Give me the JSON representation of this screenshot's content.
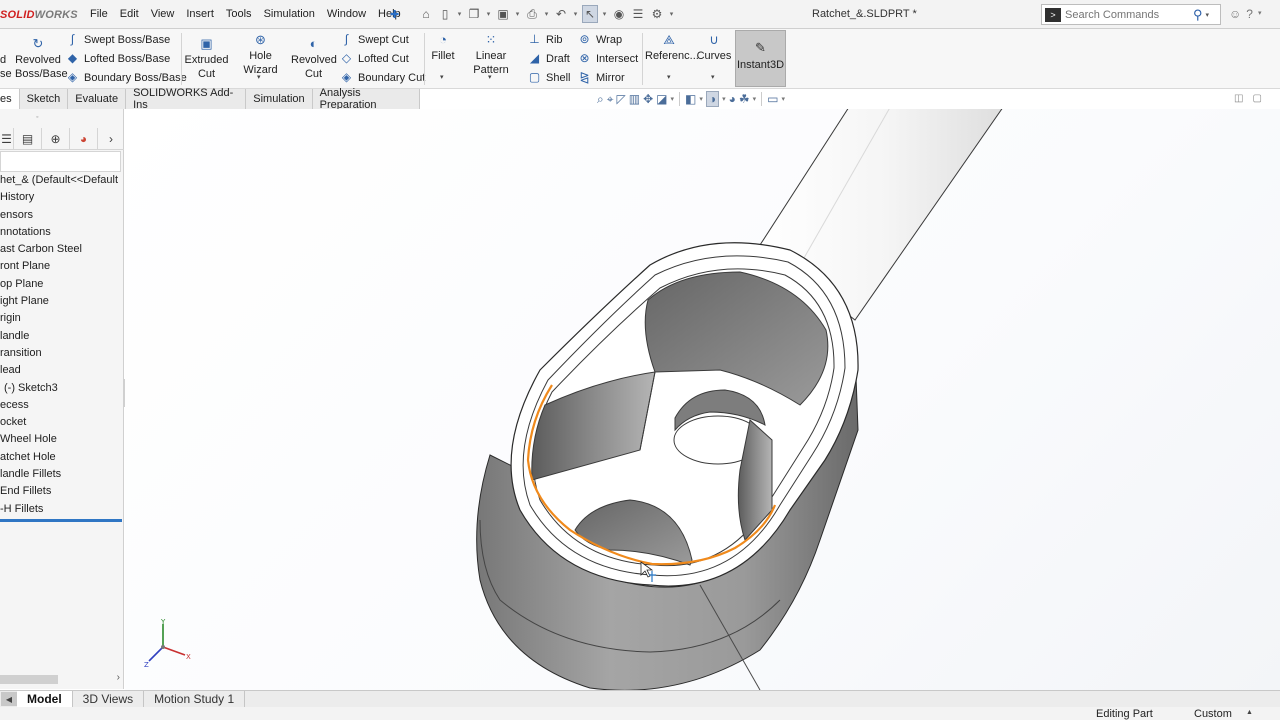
{
  "app": {
    "logo_red": "SOLID",
    "logo_grey": "WORKS",
    "document_title": "Ratchet_&.SLDPRT *"
  },
  "menu": [
    "File",
    "Edit",
    "View",
    "Insert",
    "Tools",
    "Simulation",
    "Window",
    "Help"
  ],
  "quick_access_icons": [
    "home-icon",
    "new-document-icon",
    "open-icon",
    "save-icon",
    "print-icon",
    "undo-icon",
    "select-icon",
    "rebuild-icon",
    "file-properties-icon",
    "options-icon"
  ],
  "search": {
    "placeholder": "Search Commands"
  },
  "command_manager": {
    "extruded_boss_partial_top": "d",
    "extruded_boss_partial_bottom": "se",
    "revolved_boss": "Revolved Boss/Base",
    "swept_boss": "Swept Boss/Base",
    "lofted_boss": "Lofted Boss/Base",
    "boundary_boss": "Boundary Boss/Base",
    "extruded_cut": "Extruded Cut",
    "hole_wizard": "Hole Wizard",
    "revolved_cut": "Revolved Cut",
    "swept_cut": "Swept Cut",
    "lofted_cut": "Lofted Cut",
    "boundary_cut": "Boundary Cut",
    "fillet": "Fillet",
    "linear_pattern": "Linear Pattern",
    "rib": "Rib",
    "draft": "Draft",
    "shell": "Shell",
    "wrap": "Wrap",
    "intersect": "Intersect",
    "mirror": "Mirror",
    "reference_geometry": "Referenc...",
    "curves": "Curves",
    "instant3d": "Instant3D"
  },
  "tabs": [
    {
      "label": "es",
      "active": true
    },
    {
      "label": "Sketch",
      "active": false
    },
    {
      "label": "Evaluate",
      "active": false
    },
    {
      "label": "SOLIDWORKS Add-Ins",
      "active": false
    },
    {
      "label": "Simulation",
      "active": false
    },
    {
      "label": "Analysis Preparation",
      "active": false
    }
  ],
  "feature_tree": [
    "het_&  (Default<<Default",
    "History",
    "ensors",
    "nnotations",
    "ast Carbon Steel",
    "ront Plane",
    "op Plane",
    "ight Plane",
    "rigin",
    "landle",
    "ransition",
    "lead",
    "(-) Sketch3",
    "ecess",
    "ocket",
    "Wheel Hole",
    "atchet Hole",
    "landle Fillets",
    "End Fillets",
    "-H Fillets"
  ],
  "bottom_tabs": [
    {
      "label": "Model",
      "active": true
    },
    {
      "label": "3D Views",
      "active": false
    },
    {
      "label": "Motion Study 1",
      "active": false
    }
  ],
  "status": {
    "mode": "Editing Part",
    "units": "Custom"
  },
  "colors": {
    "selection_edge": "#f08a1c",
    "rollback_bar": "#2f76c4",
    "logo_red": "#d02020"
  }
}
